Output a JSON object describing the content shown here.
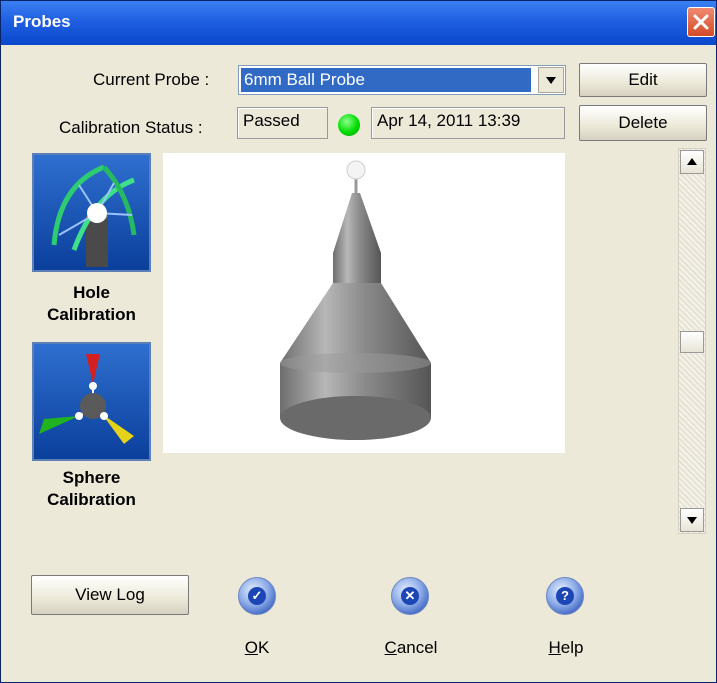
{
  "window": {
    "title": "Probes"
  },
  "probe": {
    "current_label": "Current Probe :",
    "current_value": "6mm Ball Probe",
    "edit_label": "Edit",
    "delete_label": "Delete"
  },
  "calibration": {
    "status_label": "Calibration Status :",
    "status_value": "Passed",
    "status_color": "#00dd00",
    "date": "Apr 14, 2011 13:39"
  },
  "tools": [
    {
      "line1": "Hole",
      "line2": "Calibration",
      "icon": "hole-calibration-icon"
    },
    {
      "line1": "Sphere",
      "line2": "Calibration",
      "icon": "sphere-calibration-icon"
    }
  ],
  "footer": {
    "view_log": "View Log",
    "ok": {
      "mnemonic": "O",
      "rest": "K"
    },
    "cancel": {
      "mnemonic": "C",
      "rest": "ancel"
    },
    "help": {
      "mnemonic": "H",
      "rest": "elp"
    }
  },
  "colors": {
    "title_bar": "#1f5fe0",
    "selection": "#316ac5",
    "dialog_bg": "#ece9d8"
  }
}
